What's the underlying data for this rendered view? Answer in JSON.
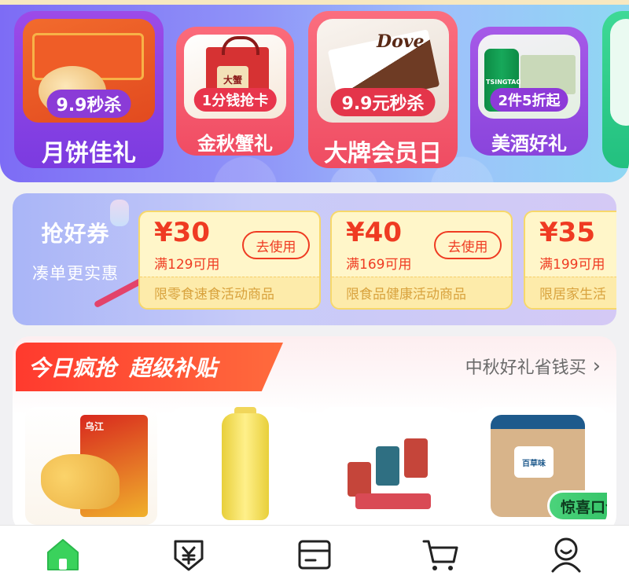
{
  "banner": {
    "cards": [
      {
        "tag": "9.9秒杀",
        "title": "月饼佳礼"
      },
      {
        "tag": "1分钱抢卡",
        "title": "金秋蟹礼",
        "art_text": "大蟹"
      },
      {
        "tag": "9.9元秒杀",
        "title": "大牌会员日",
        "art_text": "Dove"
      },
      {
        "tag": "2件5折起",
        "title": "美酒好礼",
        "art_text": "TSINGTAO"
      }
    ]
  },
  "coupons": {
    "heading": "抢好券",
    "subheading": "凑单更实惠",
    "items": [
      {
        "amount": "¥30",
        "condition": "满129可用",
        "button": "去使用",
        "limit": "限零食速食活动商品"
      },
      {
        "amount": "¥40",
        "condition": "满169可用",
        "button": "去使用",
        "limit": "限食品健康活动商品"
      },
      {
        "amount": "¥35",
        "condition": "满199可用",
        "limit": "限居家生活"
      }
    ]
  },
  "sale": {
    "title": "今日疯抢",
    "subtitle": "超级补贴",
    "more": "中秋好礼省钱买",
    "products": [
      {
        "art_text": "乌江"
      },
      {},
      {},
      {
        "art_text": "百草味",
        "badge": "惊喜口令"
      }
    ]
  },
  "nav": {
    "items": [
      {
        "icon": "home-icon",
        "active": true
      },
      {
        "icon": "yuan-coupon-icon",
        "active": false
      },
      {
        "icon": "card-icon",
        "active": false
      },
      {
        "icon": "cart-icon",
        "active": false
      },
      {
        "icon": "profile-icon",
        "active": false
      }
    ]
  },
  "colors": {
    "accent_green": "#3ad25c",
    "coupon_red": "#ef3b22",
    "sale_red": "#ff3a2e"
  }
}
